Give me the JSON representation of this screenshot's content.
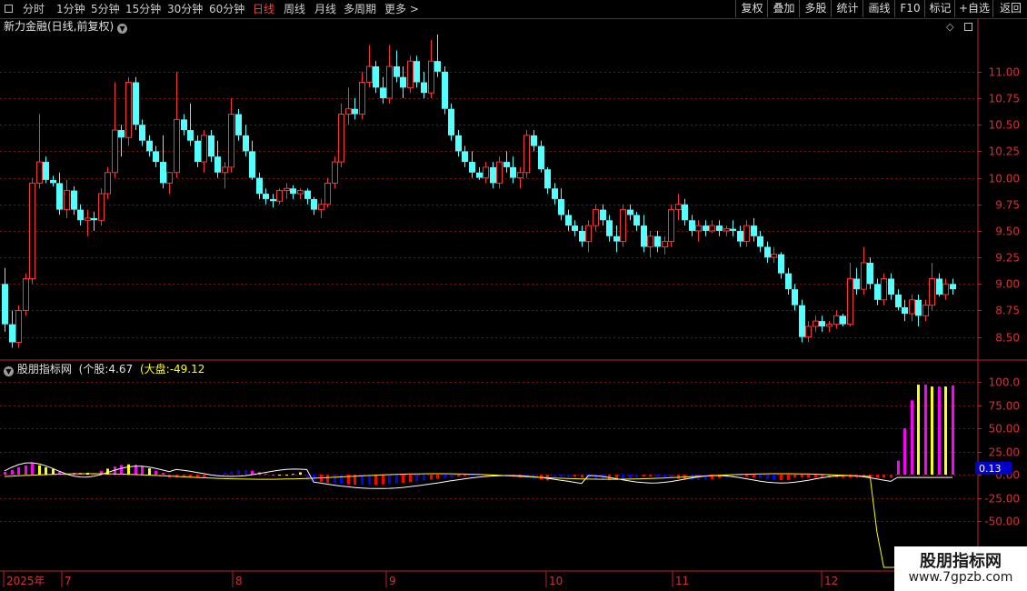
{
  "toolbar": {
    "periods": [
      {
        "label": "分时",
        "active": false
      },
      {
        "label": "1分钟",
        "active": false
      },
      {
        "label": "5分钟",
        "active": false
      },
      {
        "label": "15分钟",
        "active": false
      },
      {
        "label": "30分钟",
        "active": false
      },
      {
        "label": "60分钟",
        "active": false
      },
      {
        "label": "日线",
        "active": true
      },
      {
        "label": "周线",
        "active": false
      },
      {
        "label": "月线",
        "active": false
      },
      {
        "label": "多周期",
        "active": false
      }
    ],
    "more_label": "更多",
    "more_arrow": ">",
    "buttons": [
      "复权",
      "叠加",
      "多股",
      "统计",
      "画线",
      "F10",
      "+自选",
      "返回"
    ],
    "label_button": "标记"
  },
  "price_pane": {
    "title": "新力金融(日线,前复权)",
    "y_axis_ticks": [
      "11.00",
      "10.75",
      "10.50",
      "10.25",
      "10.00",
      "9.75",
      "9.50",
      "9.25",
      "9.00",
      "8.75",
      "8.50"
    ]
  },
  "indicator_pane": {
    "name": "股朋指标网",
    "stock_label": "(个股:",
    "stock_value": "4.67",
    "market_label": "(大盘:",
    "market_value": "-49.12",
    "y_axis_ticks": [
      "100.0",
      "75.00",
      "50.00",
      "25.00",
      "0.00",
      "-25.00",
      "-50.00"
    ],
    "current_value_badge": "0.13"
  },
  "x_axis": {
    "labels": [
      "2025年",
      "7",
      "8",
      "9",
      "10",
      "11",
      "12"
    ]
  },
  "watermark": {
    "line1": "股朋指标网",
    "line2": "www.7gpzb.com"
  },
  "colors": {
    "up": "#ff3232",
    "down": "#54ffff",
    "grid": "#7a1010",
    "axis_text": "#d83030",
    "hist_magenta": "#ff00ff",
    "hist_yellow": "#ffff00",
    "hist_blue": "#0000ff",
    "hist_red": "#ff0000",
    "line_white": "#ffffff",
    "line_yellow": "#ffff00"
  },
  "chart_data": [
    {
      "type": "candlestick",
      "title": "新力金融(日线,前复权)",
      "ylim": [
        8.3,
        11.35
      ],
      "y_ticks": [
        11.0,
        10.75,
        10.5,
        10.25,
        10.0,
        9.75,
        9.5,
        9.25,
        9.0,
        8.75,
        8.5
      ],
      "x_labels": [
        "2025年",
        "7",
        "8",
        "9",
        "10",
        "11",
        "12"
      ],
      "candles": [
        [
          9.0,
          9.15,
          8.55,
          8.62
        ],
        [
          8.62,
          8.75,
          8.4,
          8.45
        ],
        [
          8.45,
          8.8,
          8.4,
          8.75
        ],
        [
          8.75,
          9.1,
          8.7,
          9.05
        ],
        [
          9.05,
          10.0,
          9.0,
          9.95
        ],
        [
          9.95,
          10.6,
          9.9,
          10.15
        ],
        [
          10.15,
          10.2,
          9.95,
          9.98
        ],
        [
          9.98,
          10.02,
          9.92,
          9.95
        ],
        [
          9.95,
          10.05,
          9.65,
          9.7
        ],
        [
          9.7,
          9.98,
          9.62,
          9.88
        ],
        [
          9.88,
          9.92,
          9.65,
          9.7
        ],
        [
          9.7,
          9.75,
          9.55,
          9.6
        ],
        [
          9.6,
          9.7,
          9.45,
          9.62
        ],
        [
          9.62,
          9.68,
          9.5,
          9.6
        ],
        [
          9.6,
          9.9,
          9.55,
          9.85
        ],
        [
          9.85,
          10.1,
          9.8,
          10.05
        ],
        [
          10.05,
          10.9,
          10.0,
          10.45
        ],
        [
          10.45,
          10.5,
          10.2,
          10.38
        ],
        [
          10.38,
          10.95,
          10.3,
          10.9
        ],
        [
          10.9,
          10.95,
          10.45,
          10.5
        ],
        [
          10.5,
          10.55,
          10.3,
          10.35
        ],
        [
          10.35,
          10.4,
          10.2,
          10.25
        ],
        [
          10.25,
          10.3,
          10.1,
          10.15
        ],
        [
          10.15,
          10.4,
          9.9,
          9.95
        ],
        [
          9.95,
          10.05,
          9.85,
          10.05
        ],
        [
          10.05,
          11.0,
          10.0,
          10.55
        ],
        [
          10.55,
          10.6,
          10.4,
          10.45
        ],
        [
          10.45,
          10.7,
          10.3,
          10.35
        ],
        [
          10.35,
          10.4,
          10.1,
          10.15
        ],
        [
          10.15,
          10.45,
          10.05,
          10.4
        ],
        [
          10.4,
          10.45,
          10.15,
          10.2
        ],
        [
          10.2,
          10.35,
          10.0,
          10.05
        ],
        [
          10.05,
          10.15,
          9.9,
          10.1
        ],
        [
          10.1,
          10.75,
          10.05,
          10.6
        ],
        [
          10.6,
          10.65,
          10.35,
          10.4
        ],
        [
          10.4,
          10.5,
          10.2,
          10.25
        ],
        [
          10.25,
          10.35,
          9.98,
          10.0
        ],
        [
          10.0,
          10.05,
          9.8,
          9.85
        ],
        [
          9.85,
          9.9,
          9.75,
          9.8
        ],
        [
          9.8,
          9.85,
          9.72,
          9.78
        ],
        [
          9.78,
          9.9,
          9.75,
          9.88
        ],
        [
          9.88,
          9.95,
          9.8,
          9.9
        ],
        [
          9.9,
          9.93,
          9.8,
          9.85
        ],
        [
          9.85,
          9.9,
          9.8,
          9.88
        ],
        [
          9.88,
          9.9,
          9.75,
          9.8
        ],
        [
          9.8,
          9.82,
          9.65,
          9.7
        ],
        [
          9.7,
          9.8,
          9.62,
          9.75
        ],
        [
          9.75,
          10.0,
          9.72,
          9.95
        ],
        [
          9.95,
          10.2,
          9.9,
          10.15
        ],
        [
          10.15,
          10.7,
          10.1,
          10.6
        ],
        [
          10.6,
          10.85,
          10.5,
          10.65
        ],
        [
          10.65,
          10.75,
          10.55,
          10.6
        ],
        [
          10.6,
          11.0,
          10.55,
          10.9
        ],
        [
          10.9,
          11.25,
          10.85,
          11.05
        ],
        [
          11.05,
          11.1,
          10.8,
          10.85
        ],
        [
          10.85,
          10.95,
          10.7,
          10.75
        ],
        [
          10.75,
          11.25,
          10.7,
          11.05
        ],
        [
          11.05,
          11.2,
          10.9,
          10.95
        ],
        [
          10.95,
          11.05,
          10.75,
          10.85
        ],
        [
          10.85,
          11.15,
          10.8,
          11.1
        ],
        [
          11.1,
          11.15,
          10.85,
          10.9
        ],
        [
          10.9,
          11.0,
          10.75,
          10.8
        ],
        [
          10.8,
          11.3,
          10.75,
          11.1
        ],
        [
          11.1,
          11.35,
          10.95,
          11.0
        ],
        [
          11.0,
          11.05,
          10.6,
          10.65
        ],
        [
          10.65,
          10.7,
          10.35,
          10.4
        ],
        [
          10.4,
          10.45,
          10.2,
          10.25
        ],
        [
          10.25,
          10.3,
          10.1,
          10.15
        ],
        [
          10.15,
          10.25,
          10.0,
          10.05
        ],
        [
          10.05,
          10.1,
          9.98,
          10.0
        ],
        [
          10.0,
          10.15,
          9.95,
          10.1
        ],
        [
          10.1,
          10.15,
          9.9,
          9.95
        ],
        [
          9.95,
          10.2,
          9.9,
          10.15
        ],
        [
          10.15,
          10.25,
          10.05,
          10.1
        ],
        [
          10.1,
          10.2,
          9.95,
          10.0
        ],
        [
          10.0,
          10.1,
          9.9,
          10.05
        ],
        [
          10.05,
          10.45,
          10.0,
          10.4
        ],
        [
          10.4,
          10.45,
          10.25,
          10.3
        ],
        [
          10.3,
          10.35,
          10.05,
          10.08
        ],
        [
          10.08,
          10.1,
          9.85,
          9.9
        ],
        [
          9.9,
          9.95,
          9.75,
          9.8
        ],
        [
          9.8,
          9.9,
          9.6,
          9.65
        ],
        [
          9.65,
          9.7,
          9.5,
          9.55
        ],
        [
          9.55,
          9.6,
          9.45,
          9.5
        ],
        [
          9.5,
          9.55,
          9.35,
          9.4
        ],
        [
          9.4,
          9.6,
          9.3,
          9.55
        ],
        [
          9.55,
          9.75,
          9.5,
          9.7
        ],
        [
          9.7,
          9.75,
          9.55,
          9.6
        ],
        [
          9.6,
          9.65,
          9.4,
          9.45
        ],
        [
          9.45,
          9.55,
          9.3,
          9.4
        ],
        [
          9.4,
          9.75,
          9.35,
          9.7
        ],
        [
          9.7,
          9.75,
          9.6,
          9.65
        ],
        [
          9.65,
          9.68,
          9.5,
          9.55
        ],
        [
          9.55,
          9.65,
          9.3,
          9.35
        ],
        [
          9.35,
          9.5,
          9.25,
          9.45
        ],
        [
          9.45,
          9.5,
          9.3,
          9.35
        ],
        [
          9.35,
          9.45,
          9.28,
          9.4
        ],
        [
          9.4,
          9.75,
          9.35,
          9.7
        ],
        [
          9.7,
          9.85,
          9.6,
          9.75
        ],
        [
          9.75,
          9.8,
          9.55,
          9.6
        ],
        [
          9.6,
          9.65,
          9.45,
          9.5
        ],
        [
          9.5,
          9.6,
          9.4,
          9.55
        ],
        [
          9.55,
          9.6,
          9.45,
          9.5
        ],
        [
          9.5,
          9.6,
          9.48,
          9.55
        ],
        [
          9.55,
          9.6,
          9.45,
          9.5
        ],
        [
          9.5,
          9.55,
          9.45,
          9.52
        ],
        [
          9.52,
          9.6,
          9.45,
          9.5
        ],
        [
          9.5,
          9.55,
          9.35,
          9.4
        ],
        [
          9.4,
          9.6,
          9.35,
          9.55
        ],
        [
          9.55,
          9.62,
          9.4,
          9.45
        ],
        [
          9.45,
          9.5,
          9.3,
          9.35
        ],
        [
          9.35,
          9.4,
          9.2,
          9.25
        ],
        [
          9.25,
          9.35,
          9.2,
          9.28
        ],
        [
          9.28,
          9.3,
          9.05,
          9.1
        ],
        [
          9.1,
          9.15,
          8.9,
          8.95
        ],
        [
          8.95,
          9.0,
          8.75,
          8.8
        ],
        [
          8.8,
          8.85,
          8.45,
          8.5
        ],
        [
          8.5,
          8.65,
          8.45,
          8.6
        ],
        [
          8.6,
          8.7,
          8.55,
          8.65
        ],
        [
          8.65,
          8.7,
          8.55,
          8.6
        ],
        [
          8.6,
          8.65,
          8.55,
          8.62
        ],
        [
          8.62,
          8.75,
          8.58,
          8.7
        ],
        [
          8.7,
          8.72,
          8.6,
          8.62
        ],
        [
          8.62,
          9.2,
          8.6,
          9.05
        ],
        [
          9.05,
          9.15,
          8.9,
          8.95
        ],
        [
          8.95,
          9.35,
          8.9,
          9.2
        ],
        [
          9.2,
          9.25,
          8.95,
          9.0
        ],
        [
          9.0,
          9.05,
          8.8,
          8.85
        ],
        [
          8.85,
          9.1,
          8.8,
          9.05
        ],
        [
          9.05,
          9.1,
          8.85,
          8.9
        ],
        [
          8.9,
          8.95,
          8.75,
          8.78
        ],
        [
          8.78,
          8.85,
          8.65,
          8.72
        ],
        [
          8.72,
          8.9,
          8.65,
          8.85
        ],
        [
          8.85,
          8.9,
          8.6,
          8.7
        ],
        [
          8.7,
          8.85,
          8.65,
          8.8
        ],
        [
          8.8,
          9.2,
          8.75,
          9.05
        ],
        [
          9.05,
          9.1,
          8.88,
          8.9
        ],
        [
          8.9,
          9.05,
          8.85,
          9.0
        ],
        [
          9.0,
          9.05,
          8.9,
          8.95
        ]
      ]
    },
    {
      "type": "bar",
      "title": "股朋指标网",
      "ylim": [
        -100,
        110
      ],
      "y_ticks": [
        100,
        75,
        50,
        25,
        0,
        -25,
        -50
      ],
      "stock_value": 4.67,
      "market_value": -49.12
    }
  ]
}
